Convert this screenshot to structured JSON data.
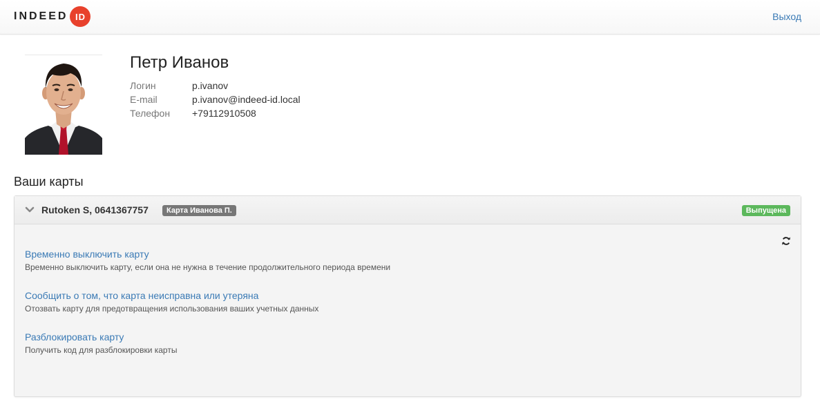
{
  "header": {
    "logo_text": "INDEED",
    "logo_badge": "ID",
    "logout_label": "Выход"
  },
  "profile": {
    "name": "Петр Иванов",
    "fields": [
      {
        "label": "Логин",
        "value": "p.ivanov"
      },
      {
        "label": "E-mail",
        "value": "p.ivanov@indeed-id.local"
      },
      {
        "label": "Телефон",
        "value": "+79112910508"
      }
    ]
  },
  "cards_section": {
    "title": "Ваши карты",
    "card": {
      "title": "Rutoken S, 0641367757",
      "label": "Карта Иванова П.",
      "status": "Выпущена",
      "actions": [
        {
          "link": "Временно выключить карту",
          "description": "Временно выключить карту, если она не нужна в течение продолжительного периода времени"
        },
        {
          "link": "Сообщить о том, что карта неисправна или утеряна",
          "description": "Отозвать карту для предотвращения использования ваших учетных данных"
        },
        {
          "link": "Разблокировать карту",
          "description": "Получить код для разблокировки карты"
        }
      ]
    }
  },
  "colors": {
    "link": "#3a7ab5",
    "brand_red": "#e8412c",
    "status_green": "#5cb85c",
    "label_gray": "#777777"
  }
}
